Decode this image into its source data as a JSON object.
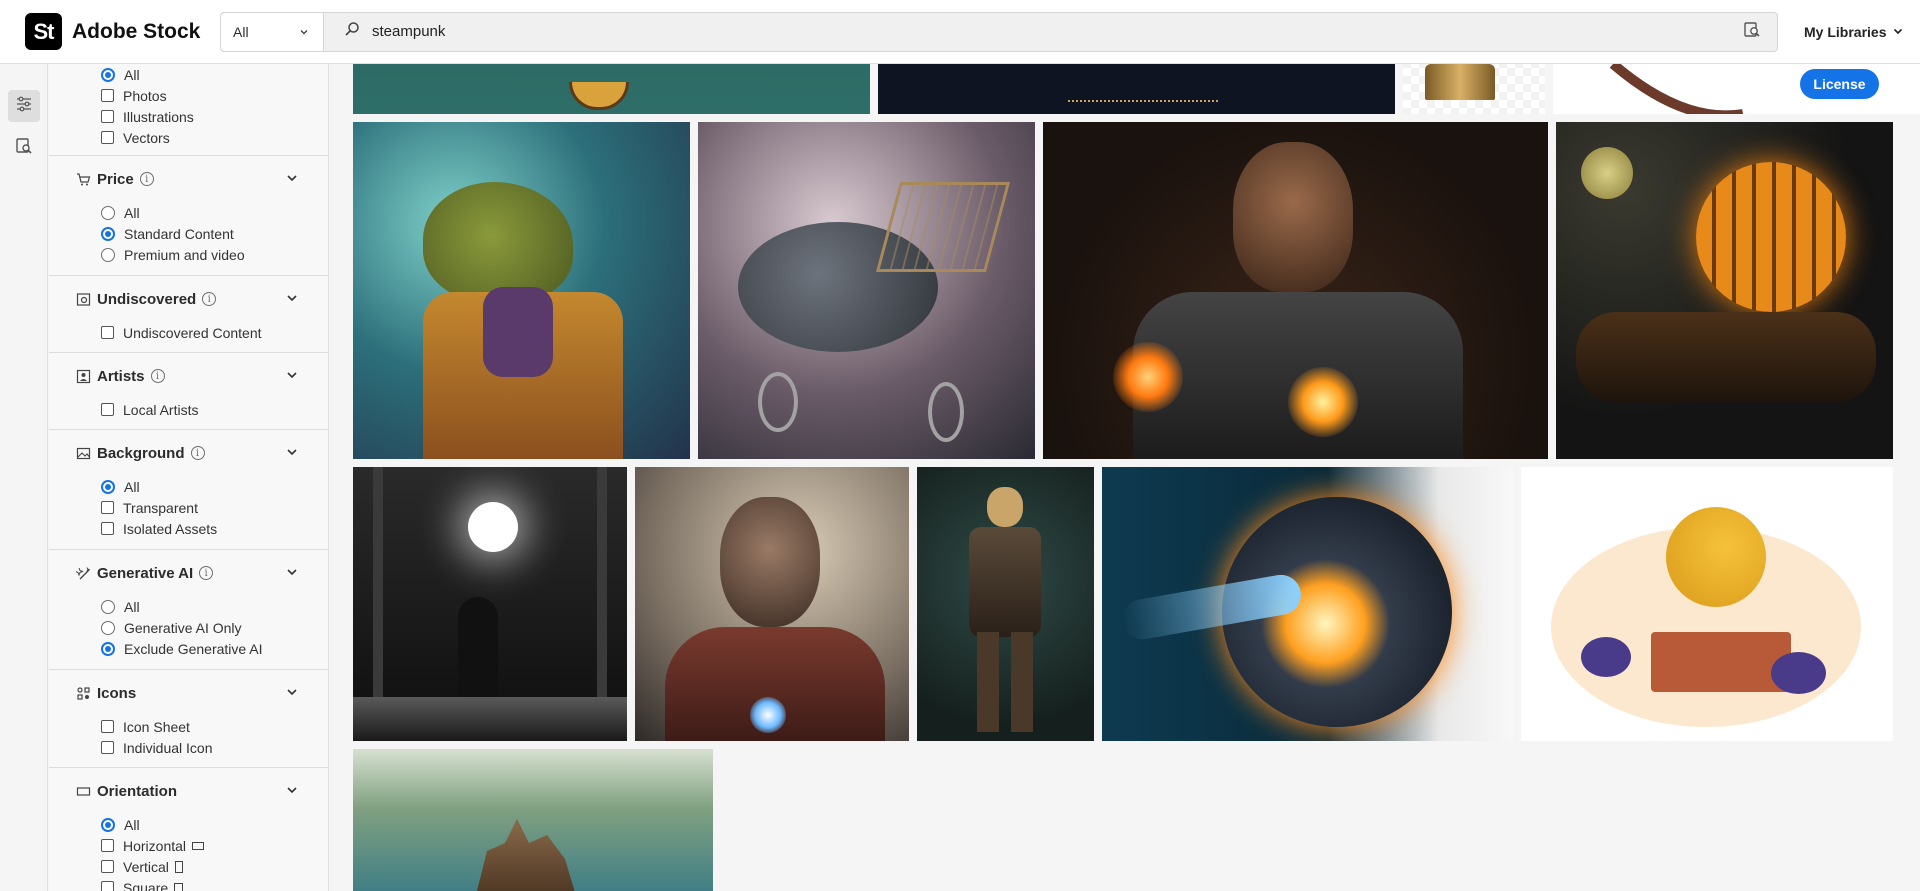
{
  "header": {
    "logo_mark": "St",
    "logo_text": "Adobe Stock",
    "search_type": "All",
    "search_query": "steampunk",
    "my_libraries": "My Libraries"
  },
  "actions": {
    "license": "License"
  },
  "filters": {
    "asset_type": {
      "options": [
        "All",
        "Photos",
        "Illustrations",
        "Vectors"
      ],
      "selected": "All"
    },
    "price": {
      "title": "Price",
      "options": [
        "All",
        "Standard Content",
        "Premium and video"
      ],
      "selected": "Standard Content"
    },
    "undiscovered": {
      "title": "Undiscovered",
      "options": [
        "Undiscovered Content"
      ]
    },
    "artists": {
      "title": "Artists",
      "options": [
        "Local Artists"
      ]
    },
    "background": {
      "title": "Background",
      "options": [
        "All",
        "Transparent",
        "Isolated Assets"
      ],
      "selected": "All"
    },
    "generative_ai": {
      "title": "Generative AI",
      "options": [
        "All",
        "Generative AI Only",
        "Exclude Generative AI"
      ],
      "selected": "Exclude Generative AI"
    },
    "icons": {
      "title": "Icons",
      "options": [
        "Icon Sheet",
        "Individual Icon"
      ]
    },
    "orientation": {
      "title": "Orientation",
      "options": [
        "All",
        "Horizontal",
        "Vertical",
        "Square"
      ],
      "selected": "All"
    }
  },
  "results": [
    "steampunk teal illustration",
    "steampunk gold ornament on navy",
    "brass object on transparent background",
    "steampunk curved horn",
    "steampunk frog adventurer",
    "mechanical flying bull",
    "cyborg man with glowing core",
    "steampunk airship at night",
    "hooded figure in barn",
    "damaged iron suit hero",
    "steampunk gentleman with gun",
    "glowing mechanical disk",
    "gramophone with flowers",
    "floating steampunk castle"
  ],
  "colors": {
    "accent": "#1473e6",
    "header_bg": "#ffffff",
    "panel_bg": "#f8f8f8"
  }
}
